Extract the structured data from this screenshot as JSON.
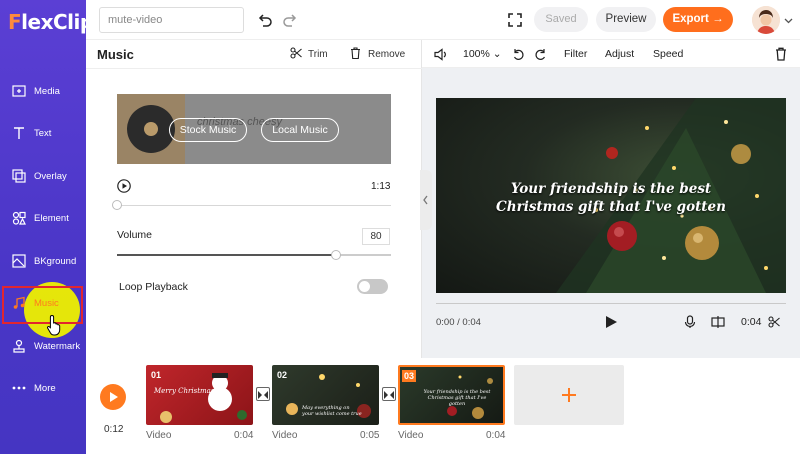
{
  "app": {
    "logo": "FlexClip",
    "logo_first": "F",
    "logo_rest": "lexClip"
  },
  "sidebar": {
    "items": [
      {
        "label": "Media",
        "icon": "media-icon"
      },
      {
        "label": "Text",
        "icon": "text-icon"
      },
      {
        "label": "Overlay",
        "icon": "overlay-icon"
      },
      {
        "label": "Element",
        "icon": "element-icon"
      },
      {
        "label": "BKground",
        "icon": "background-icon"
      },
      {
        "label": "Music",
        "icon": "music-icon",
        "active": true
      },
      {
        "label": "Watermark",
        "icon": "watermark-icon"
      },
      {
        "label": "More",
        "icon": "more-icon"
      }
    ]
  },
  "topbar": {
    "project_name": "mute-video",
    "saved_label": "Saved",
    "preview_label": "Preview",
    "export_label": "Export",
    "colors": {
      "export": "#ff6e1d"
    }
  },
  "music_panel": {
    "title": "Music",
    "trim_label": "Trim",
    "remove_label": "Remove",
    "card": {
      "ghost_title": "christmas cheesy",
      "stock_label": "Stock Music",
      "local_label": "Local Music"
    },
    "duration": "1:13",
    "progress_fraction": 0.0,
    "volume_label": "Volume",
    "volume_value": "80",
    "volume_fraction": 0.8,
    "loop_label": "Loop Playback",
    "loop_on": false
  },
  "preview": {
    "volume_zoom": "100%",
    "filter_label": "Filter",
    "adjust_label": "Adjust",
    "speed_label": "Speed",
    "caption_line1": "Your friendship is the best",
    "caption_line2": "Christmas gift that I've gotten",
    "current_time": "0:00 / 0:04",
    "duration": "0:04"
  },
  "timeline": {
    "total_time": "0:12",
    "clips": [
      {
        "num": "01",
        "type": "Video",
        "duration": "0:04",
        "text": "Merry Christmas"
      },
      {
        "num": "02",
        "type": "Video",
        "duration": "0:05",
        "text": "May everything on your wishlist come true"
      },
      {
        "num": "03",
        "type": "Video",
        "duration": "0:04",
        "text": "Your friendship is the best Christmas gift that I've gotten",
        "selected": true
      }
    ]
  }
}
